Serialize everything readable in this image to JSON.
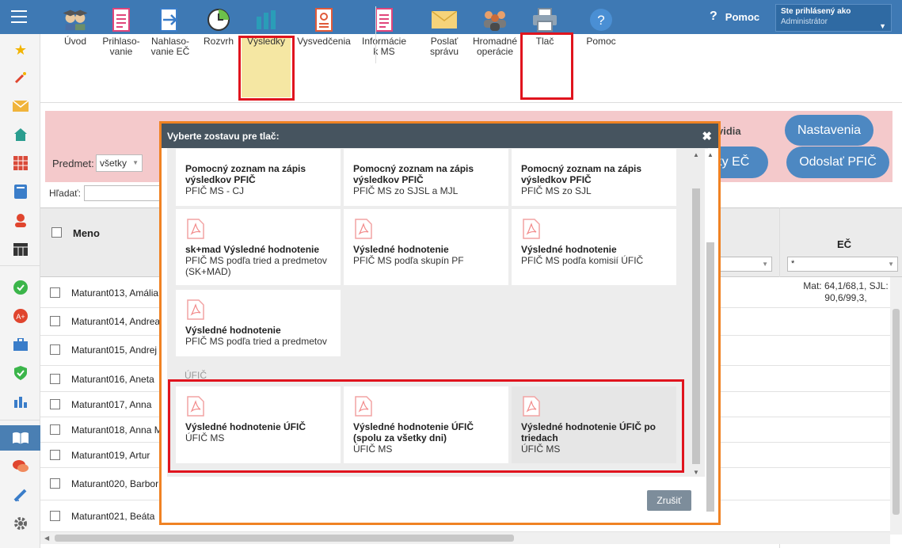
{
  "header": {
    "help_label": "Pomoc",
    "user_line1": "Ste prihlásený ako",
    "user_line2": "Administrátor"
  },
  "toolbar": {
    "items": [
      {
        "label": "Úvod"
      },
      {
        "label": "Prihlaso-\nvanie"
      },
      {
        "label": "Nahlaso-\nvanie EČ"
      },
      {
        "label": "Rozvrh"
      },
      {
        "label": "Výsledky"
      },
      {
        "label": "Vysvedčenia"
      },
      {
        "label": "Informácie\nk MS"
      },
      {
        "label": "Poslať\nsprávu"
      },
      {
        "label": "Hromadné\noperácie"
      },
      {
        "label": "Tlač"
      },
      {
        "label": "Pomoc"
      }
    ]
  },
  "filters": {
    "subject_label": "Predmet:",
    "subject_value": "všetky",
    "find_label": "Hľadať:",
    "ec_filter_value": "*"
  },
  "right_buttons": {
    "vidia_text": "vidia",
    "settings": "Nastavenia",
    "ec_button": "ky EČ",
    "send_pfic": "Odoslať PFIČ"
  },
  "grid": {
    "col_name": "Meno",
    "col_ec": "EČ",
    "rows": [
      {
        "name": "Maturant013, Amália",
        "slash": "/",
        "ec": "Mat: 64,1/68,1, SJL: 90,6/99,3,"
      },
      {
        "name": "Maturant014, Andrea",
        "slash": "/",
        "ec": ""
      },
      {
        "name": "Maturant015, Andrej",
        "slash": "/",
        "ec": ""
      },
      {
        "name": "Maturant016, Aneta",
        "slash": "/",
        "ec": ""
      },
      {
        "name": "Maturant017, Anna",
        "slash": "/",
        "ec": ""
      },
      {
        "name": "Maturant018, Anna M",
        "slash": "/",
        "ec": ""
      },
      {
        "name": "Maturant019, Artur",
        "slash": "/",
        "ec": ""
      },
      {
        "name": "Maturant020, Barbor",
        "slash": "/",
        "ec": ""
      },
      {
        "name": "Maturant021, Beáta",
        "slash": "/",
        "ec": ""
      }
    ]
  },
  "modal": {
    "title": "Vyberte zostavu pre tlač:",
    "section_ufic": "ÚFIČ",
    "cancel": "Zrušiť",
    "cards_top": [
      {
        "title": "Pomocný zoznam na zápis výsledkov PFIČ",
        "sub": "PFIČ MS - CJ"
      },
      {
        "title": "Pomocný zoznam na zápis výsledkov PFIČ",
        "sub": "PFIČ MS zo SJSL a MJL"
      },
      {
        "title": "Pomocný zoznam na zápis výsledkov PFIČ",
        "sub": "PFIČ MS zo SJL"
      }
    ],
    "cards_mid": [
      {
        "title": "sk+mad Výsledné hodnotenie",
        "sub": "PFIČ MS podľa tried a predmetov (SK+MAD)"
      },
      {
        "title": "Výsledné hodnotenie",
        "sub": "PFIČ MS podľa skupín PF"
      },
      {
        "title": "Výsledné hodnotenie",
        "sub": "PFIČ MS podľa komisií ÚFIČ"
      },
      {
        "title": "Výsledné hodnotenie",
        "sub": "PFIČ MS podľa tried a predmetov"
      }
    ],
    "cards_ufic": [
      {
        "title": "Výsledné hodnotenie ÚFIČ",
        "sub": "ÚFIČ MS"
      },
      {
        "title": "Výsledné hodnotenie ÚFIČ (spolu za všetky dni)",
        "sub": "ÚFIČ MS"
      },
      {
        "title": "Výsledné hodnotenie ÚFIČ po triedach",
        "sub": "ÚFIČ MS"
      }
    ]
  },
  "colors": {
    "topbar": "#3e79b4",
    "modal_header": "#46545f",
    "highlight_red": "#e0141e",
    "modal_outline": "#f08223",
    "pill_blue": "#4d88c2"
  }
}
